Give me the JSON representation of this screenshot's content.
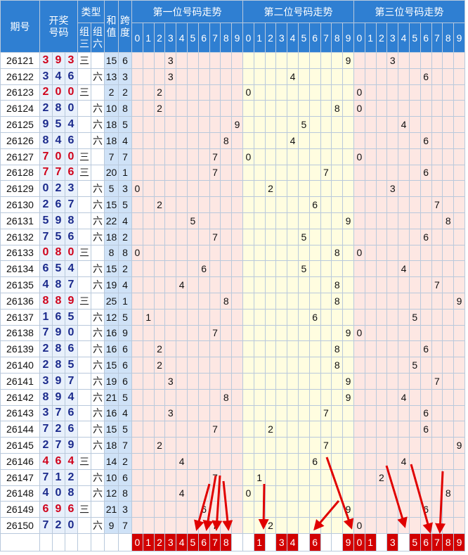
{
  "header": {
    "period": "期号",
    "draw": "开奖\n号码",
    "type": "类型",
    "zu3": "组\n三",
    "zu6": "组\n六",
    "sum": "和\n值",
    "span": "跨\n度",
    "pos1": "第一位号码走势",
    "pos2": "第二位号码走势",
    "pos3": "第三位号码走势"
  },
  "digits": [
    "0",
    "1",
    "2",
    "3",
    "4",
    "5",
    "6",
    "7",
    "8",
    "9"
  ],
  "rows": [
    {
      "period": "26121",
      "n": [
        3,
        9,
        3
      ],
      "zx": "三",
      "sum": 15,
      "span": 6
    },
    {
      "period": "26122",
      "n": [
        3,
        4,
        6
      ],
      "zx": "六",
      "sum": 13,
      "span": 3
    },
    {
      "period": "26123",
      "n": [
        2,
        0,
        0
      ],
      "zx": "三",
      "sum": 2,
      "span": 2
    },
    {
      "period": "26124",
      "n": [
        2,
        8,
        0
      ],
      "zx": "六",
      "sum": 10,
      "span": 8
    },
    {
      "period": "26125",
      "n": [
        9,
        5,
        4
      ],
      "zx": "六",
      "sum": 18,
      "span": 5
    },
    {
      "period": "26126",
      "n": [
        8,
        4,
        6
      ],
      "zx": "六",
      "sum": 18,
      "span": 4
    },
    {
      "period": "26127",
      "n": [
        7,
        0,
        0
      ],
      "zx": "三",
      "sum": 7,
      "span": 7
    },
    {
      "period": "26128",
      "n": [
        7,
        7,
        6
      ],
      "zx": "三",
      "sum": 20,
      "span": 1
    },
    {
      "period": "26129",
      "n": [
        0,
        2,
        3
      ],
      "zx": "六",
      "sum": 5,
      "span": 3
    },
    {
      "period": "26130",
      "n": [
        2,
        6,
        7
      ],
      "zx": "六",
      "sum": 15,
      "span": 5
    },
    {
      "period": "26131",
      "n": [
        5,
        9,
        8
      ],
      "zx": "六",
      "sum": 22,
      "span": 4
    },
    {
      "period": "26132",
      "n": [
        7,
        5,
        6
      ],
      "zx": "六",
      "sum": 18,
      "span": 2
    },
    {
      "period": "26133",
      "n": [
        0,
        8,
        0
      ],
      "zx": "三",
      "sum": 8,
      "span": 8
    },
    {
      "period": "26134",
      "n": [
        6,
        5,
        4
      ],
      "zx": "六",
      "sum": 15,
      "span": 2
    },
    {
      "period": "26135",
      "n": [
        4,
        8,
        7
      ],
      "zx": "六",
      "sum": 19,
      "span": 4
    },
    {
      "period": "26136",
      "n": [
        8,
        8,
        9
      ],
      "zx": "三",
      "sum": 25,
      "span": 1
    },
    {
      "period": "26137",
      "n": [
        1,
        6,
        5
      ],
      "zx": "六",
      "sum": 12,
      "span": 5
    },
    {
      "period": "26138",
      "n": [
        7,
        9,
        0
      ],
      "zx": "六",
      "sum": 16,
      "span": 9
    },
    {
      "period": "26139",
      "n": [
        2,
        8,
        6
      ],
      "zx": "六",
      "sum": 16,
      "span": 6
    },
    {
      "period": "26140",
      "n": [
        2,
        8,
        5
      ],
      "zx": "六",
      "sum": 15,
      "span": 6
    },
    {
      "period": "26141",
      "n": [
        3,
        9,
        7
      ],
      "zx": "六",
      "sum": 19,
      "span": 6
    },
    {
      "period": "26142",
      "n": [
        8,
        9,
        4
      ],
      "zx": "六",
      "sum": 21,
      "span": 5
    },
    {
      "period": "26143",
      "n": [
        3,
        7,
        6
      ],
      "zx": "六",
      "sum": 16,
      "span": 4
    },
    {
      "period": "26144",
      "n": [
        7,
        2,
        6
      ],
      "zx": "六",
      "sum": 15,
      "span": 5
    },
    {
      "period": "26145",
      "n": [
        2,
        7,
        9
      ],
      "zx": "六",
      "sum": 18,
      "span": 7
    },
    {
      "period": "26146",
      "n": [
        4,
        6,
        4
      ],
      "zx": "三",
      "sum": 14,
      "span": 2
    },
    {
      "period": "26147",
      "n": [
        7,
        1,
        2
      ],
      "zx": "六",
      "sum": 10,
      "span": 6
    },
    {
      "period": "26148",
      "n": [
        4,
        0,
        8
      ],
      "zx": "六",
      "sum": 12,
      "span": 8
    },
    {
      "period": "26149",
      "n": [
        6,
        9,
        6
      ],
      "zx": "三",
      "sum": 21,
      "span": 3
    },
    {
      "period": "26150",
      "n": [
        7,
        2,
        0
      ],
      "zx": "六",
      "sum": 9,
      "span": 7
    }
  ],
  "footer": {
    "pos1": [
      "0",
      "1",
      "2",
      "3",
      "4",
      "5",
      "6",
      "7",
      "8",
      ""
    ],
    "pos2": [
      "",
      "1",
      "",
      "3",
      "4",
      "",
      "6",
      "",
      "",
      "9"
    ],
    "pos3": [
      "0",
      "1",
      "",
      "3",
      "",
      "5",
      "6",
      "7",
      "8",
      "9"
    ],
    "pos1_red": [
      true,
      true,
      true,
      true,
      true,
      true,
      true,
      true,
      true,
      false
    ],
    "pos2_red": [
      false,
      true,
      false,
      true,
      true,
      false,
      true,
      false,
      false,
      true
    ],
    "pos3_red": [
      false,
      false,
      false,
      true,
      false,
      true,
      true,
      true,
      false,
      false
    ]
  },
  "chart_data": {
    "type": "table",
    "title": "",
    "series": [
      {
        "name": "第一位号码走势",
        "values": [
          3,
          3,
          2,
          2,
          9,
          8,
          7,
          7,
          0,
          2,
          5,
          7,
          0,
          6,
          4,
          8,
          1,
          7,
          2,
          2,
          3,
          8,
          3,
          7,
          2,
          4,
          7,
          4,
          6,
          7
        ]
      },
      {
        "name": "第二位号码走势",
        "values": [
          9,
          4,
          0,
          8,
          5,
          4,
          0,
          7,
          2,
          6,
          9,
          5,
          8,
          5,
          8,
          8,
          6,
          9,
          8,
          8,
          9,
          9,
          7,
          2,
          7,
          6,
          1,
          0,
          9,
          2
        ]
      },
      {
        "name": "第三位号码走势",
        "values": [
          3,
          6,
          0,
          0,
          4,
          6,
          0,
          6,
          3,
          7,
          8,
          6,
          0,
          4,
          7,
          9,
          5,
          0,
          6,
          5,
          7,
          4,
          6,
          6,
          9,
          4,
          2,
          8,
          6,
          0
        ]
      }
    ],
    "x": [
      "26121",
      "26122",
      "26123",
      "26124",
      "26125",
      "26126",
      "26127",
      "26128",
      "26129",
      "26130",
      "26131",
      "26132",
      "26133",
      "26134",
      "26135",
      "26136",
      "26137",
      "26138",
      "26139",
      "26140",
      "26141",
      "26142",
      "26143",
      "26144",
      "26145",
      "26146",
      "26147",
      "26148",
      "26149",
      "26150"
    ],
    "arrow_color": "#e00000"
  },
  "colors": {
    "header_bg": "#2f7fd2",
    "red_digit": "#d0021b",
    "blue_digit": "#1b2a8c",
    "pos1_bg": "#fde7e3",
    "pos2_bg": "#fffde0",
    "pos3_bg": "#fde7e3",
    "footer_red": "#d20000"
  }
}
